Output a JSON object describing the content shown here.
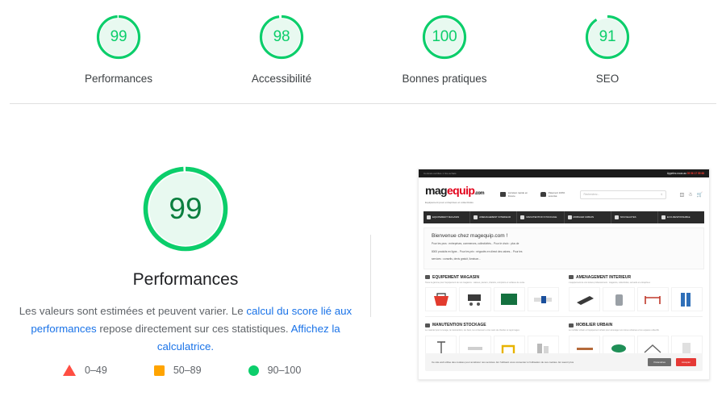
{
  "summary": {
    "gauges": [
      {
        "score": 99,
        "label": "Performances",
        "color": "#0cce6b"
      },
      {
        "score": 98,
        "label": "Accessibilité",
        "color": "#0cce6b"
      },
      {
        "score": 100,
        "label": "Bonnes pratiques",
        "color": "#0cce6b"
      },
      {
        "score": 91,
        "label": "SEO",
        "color": "#0cce6b"
      }
    ]
  },
  "detail": {
    "score": 99,
    "title": "Performances",
    "desc_part1": "Les valeurs sont estimées et peuvent varier. Le ",
    "link1": "calcul du score lié aux performances",
    "desc_part2": " repose directement sur ces statistiques. ",
    "link2": "Affichez la calculatrice.",
    "legend": [
      {
        "shape": "triangle",
        "range": "0–49",
        "color": "#ff4e42"
      },
      {
        "shape": "square",
        "range": "50–89",
        "color": "#ffa400"
      },
      {
        "shape": "circle",
        "range": "90–100",
        "color": "#0cce6b"
      }
    ]
  },
  "screenshot": {
    "topbar": {
      "left": "Contrats certifiés 1 Vos achats",
      "right_label": "Appelez-nous au",
      "right_phone": "05 56 17 55 68"
    },
    "logo": {
      "part1": "mag",
      "part2": "equip",
      "part3": ".com",
      "tagline": "Equipement pour entreprises et collectivités"
    },
    "features": [
      {
        "icon": "truck-icon",
        "text": "Livraison rapide en France"
      },
      {
        "icon": "lock-icon",
        "text": "Paiement 100% sécurisé"
      }
    ],
    "search_placeholder": "Recherchez...",
    "nav": [
      "EQUIPEMENT MAGASIN",
      "AMENAGEMENT INTERIEUR",
      "MANUTENTION STOCKAGE",
      "MOBILIER URBAIN",
      "NOUVEAUTES",
      "ECO-RESPONSABLE"
    ],
    "hero": {
      "title": "Bienvenue chez magequip.com !",
      "line1": "Pour les pros : entreprises, commerces, collectivités... Pour le choix : plus de",
      "line2": "8000 produits en ligne... Pour les prix : négociés en direct des usines... Pour les",
      "line3": "services : conseils, devis gratuit, livraison..."
    },
    "categories": [
      {
        "title": "EQUIPEMENT MAGASIN",
        "sub": "Toute la gamme pour l'équipement de vos magasins : caisses, paniers, chariots, comptoirs et surfaces de vente"
      },
      {
        "title": "AMENAGEMENT INTERIEUR",
        "sub": "L'équipement de vos locaux professionnels : magasins, collectivités, accueils et entreprises"
      },
      {
        "title": "MANUTENTION STOCKAGE",
        "sub": "Le matériel pour le levage, la manutention, les bacs, les conteneurs et les sacs de chantier et rayonnages"
      },
      {
        "title": "MOBILIER URBAIN",
        "sub": "Le mobilier urbain et l'équipement urbain pour aménager vos zones urbaines et les espaces collectifs"
      }
    ],
    "cookie": {
      "text": "Ce site web utilise des cookies pour améliorer nos services. En l'utilisant vous consentez à l'utilisation de ces cookies. En savoir plus",
      "btn_settings": "Paramètres",
      "btn_accept": "Accepter"
    }
  }
}
